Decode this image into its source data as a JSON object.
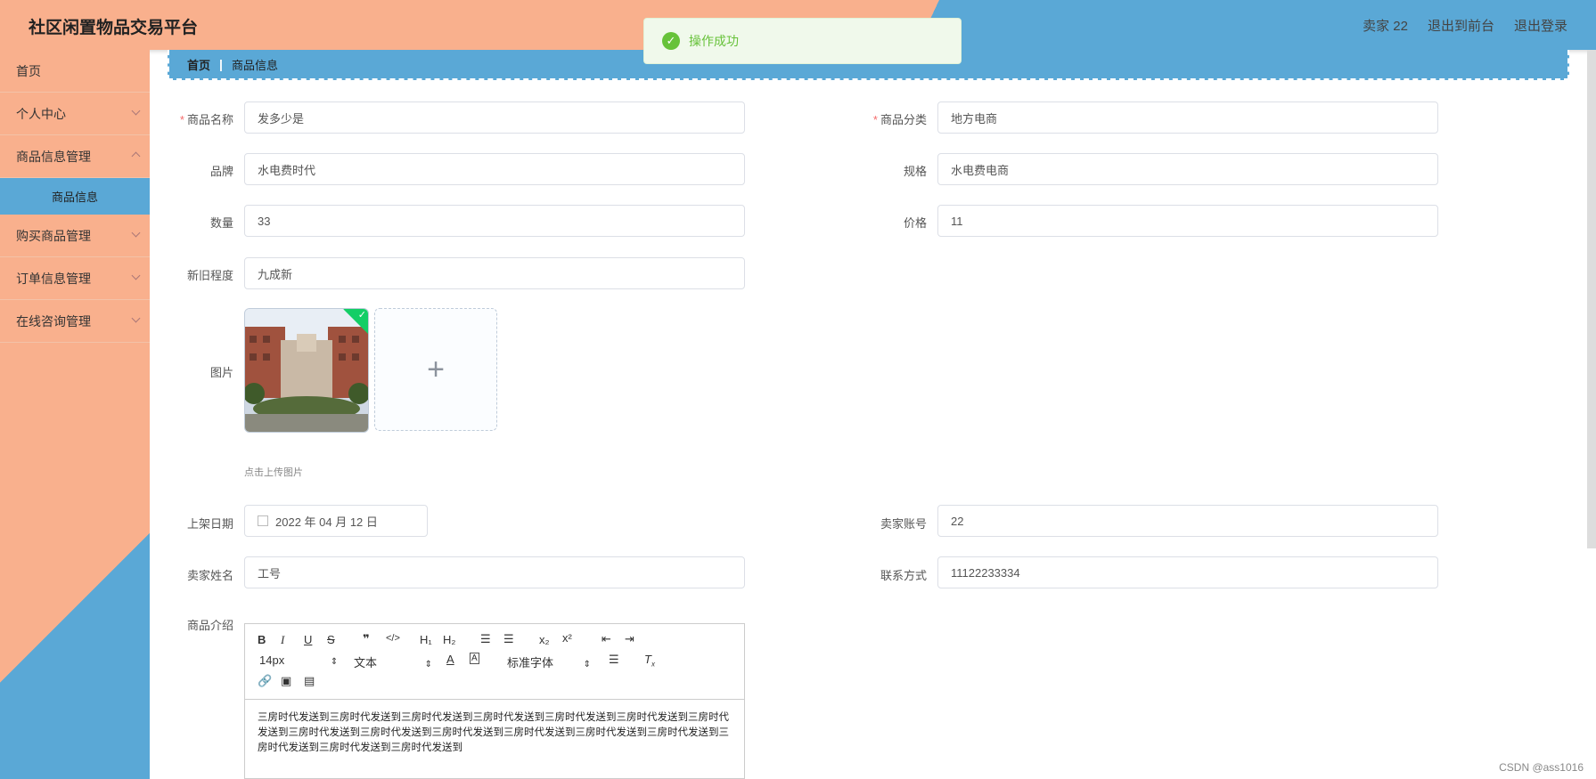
{
  "app": {
    "title": "社区闲置物品交易平台"
  },
  "header": {
    "user": "卖家 22",
    "to_front": "退出到前台",
    "logout": "退出登录"
  },
  "toast": {
    "text": "操作成功",
    "icon": "check-circle-icon",
    "color": "#67c23a"
  },
  "sidebar": {
    "items": [
      {
        "label": "首页"
      },
      {
        "label": "个人中心"
      },
      {
        "label": "商品信息管理"
      },
      {
        "label": "购买商品管理"
      },
      {
        "label": "订单信息管理"
      },
      {
        "label": "在线咨询管理"
      }
    ],
    "sub_active": "商品信息"
  },
  "breadcrumb": {
    "home": "首页",
    "current": "商品信息"
  },
  "form": {
    "name_label": "商品名称",
    "name_value": "发多少是",
    "category_label": "商品分类",
    "category_value": "地方电商",
    "brand_label": "品牌",
    "brand_value": "水电费时代",
    "spec_label": "规格",
    "spec_value": "水电费电商",
    "qty_label": "数量",
    "qty_value": "33",
    "price_label": "价格",
    "price_value": "11",
    "condition_label": "新旧程度",
    "condition_value": "九成新",
    "image_label": "图片",
    "upload_tip": "点击上传图片",
    "date_label": "上架日期",
    "date_value": "2022 年 04 月 12 日",
    "seller_account_label": "卖家账号",
    "seller_account_value": "22",
    "seller_name_label": "卖家姓名",
    "seller_name_value": "工号",
    "contact_label": "联系方式",
    "contact_value": "11122233334",
    "intro_label": "商品介绍"
  },
  "editor": {
    "font_size": "14px",
    "block": "文本",
    "font_family": "标准字体",
    "content": "三房时代发送到三房时代发送到三房时代发送到三房时代发送到三房时代发送到三房时代发送到三房时代发送到三房时代发送到三房时代发送到三房时代发送到三房时代发送到三房时代发送到三房时代发送到三房时代发送到三房时代发送到三房时代发送到"
  },
  "watermark": "CSDN @ass1016",
  "colors": {
    "peach": "#f9b08d",
    "blue": "#5aa8d6",
    "success": "#67c23a"
  }
}
